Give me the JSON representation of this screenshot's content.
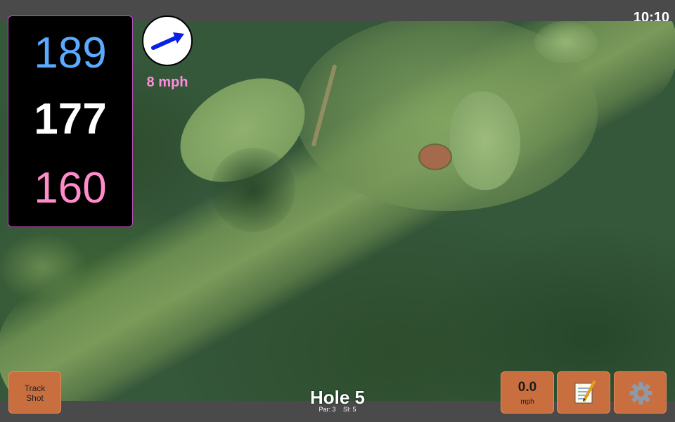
{
  "status": {
    "time": "10:10"
  },
  "yardages": {
    "back": "189",
    "middle": "177",
    "front": "160"
  },
  "wind": {
    "speed_label": "8 mph",
    "arrow_icon": "arrow-right-up-icon"
  },
  "hole": {
    "title": "Hole 5",
    "par_label": "Par: 3",
    "si_label": "SI: 5"
  },
  "buttons": {
    "track_shot": {
      "line1": "Track",
      "line2": "Shot"
    },
    "speed": {
      "value": "0.0",
      "unit": "mph"
    },
    "notes_icon": "notepad-icon",
    "settings_icon": "gear-icon"
  },
  "colors": {
    "back_yardage": "#5aaaff",
    "middle_yardage": "#ffffff",
    "front_yardage": "#ff8cc8",
    "wind_text": "#ff8cdc",
    "button": "#c96f3f",
    "panel_border": "#c050c0"
  }
}
